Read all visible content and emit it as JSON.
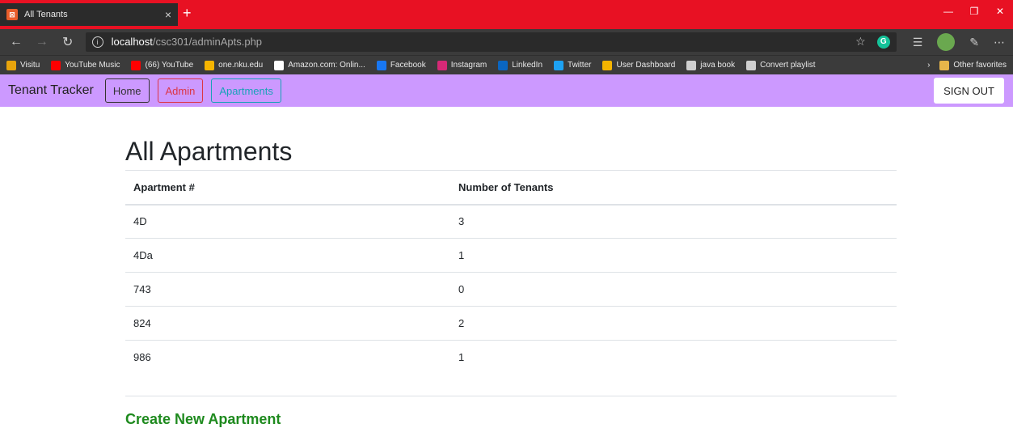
{
  "browser": {
    "tab_title": "All Tenants",
    "tab_close": "×",
    "new_tab": "+",
    "url_host": "localhost",
    "url_path": "/csc301/adminApts.php",
    "bookmarks": [
      {
        "label": "Visitu",
        "color": "#e8a40c"
      },
      {
        "label": "YouTube Music",
        "color": "#ff0000"
      },
      {
        "label": "(66) YouTube",
        "color": "#ff0000"
      },
      {
        "label": "one.nku.edu",
        "color": "#f5b400"
      },
      {
        "label": "Amazon.com: Onlin...",
        "color": "#ffffff"
      },
      {
        "label": "Facebook",
        "color": "#1877f2"
      },
      {
        "label": "Instagram",
        "color": "#d62976"
      },
      {
        "label": "LinkedIn",
        "color": "#0a66c2"
      },
      {
        "label": "Twitter",
        "color": "#1da1f2"
      },
      {
        "label": "User Dashboard",
        "color": "#f5b400"
      },
      {
        "label": "java book",
        "color": "#cfcfcf"
      },
      {
        "label": "Convert playlist",
        "color": "#cfcfcf"
      }
    ],
    "other_favorites": "Other favorites"
  },
  "nav": {
    "brand": "Tenant Tracker",
    "home": "Home",
    "admin": "Admin",
    "apartments": "Apartments",
    "sign_out": "SIGN OUT"
  },
  "page": {
    "title": "All Apartments",
    "columns": [
      "Apartment #",
      "Number of Tenants"
    ],
    "rows": [
      {
        "apt": "4D",
        "tenants": "3"
      },
      {
        "apt": "4Da",
        "tenants": "1"
      },
      {
        "apt": "743",
        "tenants": "0"
      },
      {
        "apt": "824",
        "tenants": "2"
      },
      {
        "apt": "986",
        "tenants": "1"
      }
    ],
    "create_link": "Create New Apartment"
  }
}
